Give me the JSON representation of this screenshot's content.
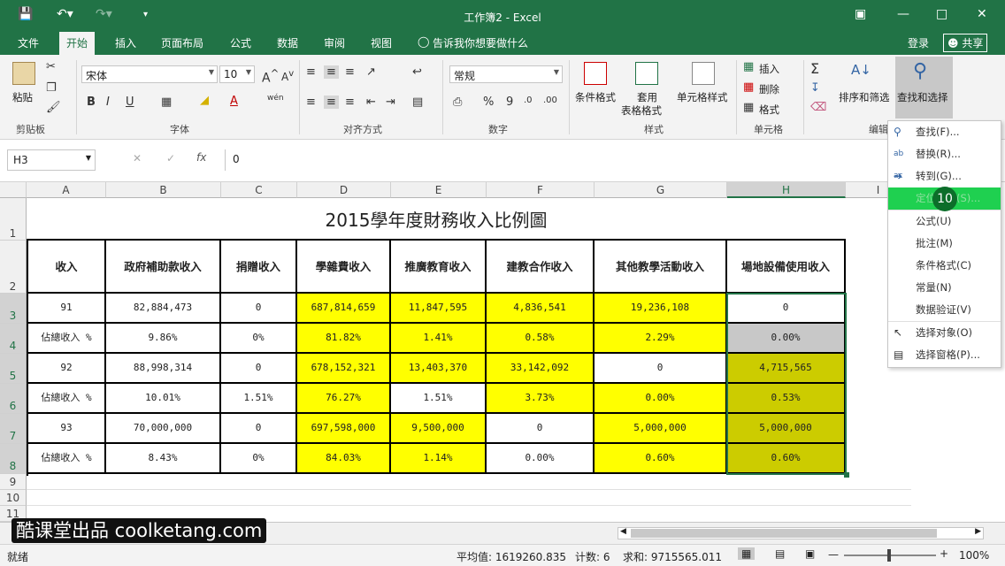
{
  "window": {
    "title": "工作簿2 - Excel"
  },
  "tabs": [
    "文件",
    "开始",
    "插入",
    "页面布局",
    "公式",
    "数据",
    "审阅",
    "视图"
  ],
  "tell_me": "告诉我你想要做什么",
  "account": {
    "login": "登录",
    "share": "共享"
  },
  "ribbon": {
    "clipboard": {
      "paste": "粘贴",
      "label": "剪贴板"
    },
    "font": {
      "name": "宋体",
      "size": "10",
      "label": "字体",
      "bold": "B",
      "italic": "I",
      "underline": "U",
      "wen": "wén"
    },
    "align": {
      "label": "对齐方式"
    },
    "number": {
      "format": "常规",
      "label": "数字",
      "percent": "%",
      "comma": "9"
    },
    "styles": {
      "cond": "条件格式",
      "table1": "套用",
      "table2": "表格格式",
      "cell": "单元格样式",
      "label": "样式"
    },
    "cells": {
      "insert": "插入",
      "delete": "删除",
      "format": "格式",
      "label": "单元格"
    },
    "editing": {
      "sort": "排序和筛选",
      "find": "查找和选择",
      "label": "编辑"
    }
  },
  "formula_bar": {
    "namebox": "H3",
    "fx": "fx",
    "value": "0"
  },
  "columns": [
    "A",
    "B",
    "C",
    "D",
    "E",
    "F",
    "G",
    "H",
    "I"
  ],
  "rows": [
    "1",
    "2",
    "3",
    "4",
    "5",
    "6",
    "7",
    "8",
    "9",
    "10",
    "11"
  ],
  "sheet": {
    "title": "2015學年度財務收入比例圖",
    "headers": [
      "收入",
      "政府補助款收入",
      "捐贈收入",
      "學雜費收入",
      "推廣教育收入",
      "建教合作收入",
      "其他教學活動收入",
      "場地設備使用收入"
    ],
    "row3": [
      "91",
      "82,884,473",
      "0",
      "687,814,659",
      "11,847,595",
      "4,836,541",
      "19,236,108",
      "0"
    ],
    "row4": [
      "佔總收入 %",
      "9.86%",
      "0%",
      "81.82%",
      "1.41%",
      "0.58%",
      "2.29%",
      "0.00%"
    ],
    "row5": [
      "92",
      "88,998,314",
      "0",
      "678,152,321",
      "13,403,370",
      "33,142,092",
      "0",
      "4,715,565"
    ],
    "row6": [
      "佔總收入 %",
      "10.01%",
      "1.51%",
      "76.27%",
      "1.51%",
      "3.73%",
      "0.00%",
      "0.53%"
    ],
    "row7": [
      "93",
      "70,000,000",
      "0",
      "697,598,000",
      "9,500,000",
      "0",
      "5,000,000",
      "5,000,000"
    ],
    "row8": [
      "佔總收入 %",
      "8.43%",
      "0%",
      "84.03%",
      "1.14%",
      "0.00%",
      "0.60%",
      "0.60%"
    ]
  },
  "menu": [
    {
      "label": "查找(F)...",
      "icon": "search-icon"
    },
    {
      "label": "替换(R)...",
      "icon": "replace-icon"
    },
    {
      "label": "转到(G)...",
      "icon": "arrow-right-icon"
    },
    {
      "label": "定位条件(S)...",
      "icon": ""
    },
    {
      "label": "公式(U)",
      "icon": ""
    },
    {
      "label": "批注(M)",
      "icon": ""
    },
    {
      "label": "条件格式(C)",
      "icon": ""
    },
    {
      "label": "常量(N)",
      "icon": ""
    },
    {
      "label": "数据验证(V)",
      "icon": ""
    },
    {
      "label": "选择对象(O)",
      "icon": "cursor-icon"
    },
    {
      "label": "选择窗格(P)...",
      "icon": "pane-icon"
    }
  ],
  "step_badge": "10",
  "watermark": "酷课堂出品 coolketang.com",
  "status": {
    "ready": "就绪",
    "avg": "平均值: 1619260.835",
    "count": "计数: 6",
    "sum": "求和: 9715565.011",
    "zoom": "100%"
  }
}
